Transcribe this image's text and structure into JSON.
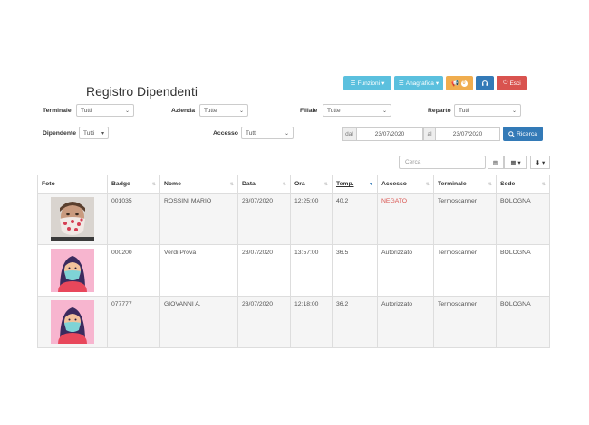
{
  "title": "Registro Dipendenti",
  "toolbar": {
    "funzioni_label": "Funzioni",
    "anagrafica_label": "Anagrafica",
    "notifications_count": "0",
    "esci_label": "Esci"
  },
  "filters": {
    "terminale": {
      "label": "Terminale",
      "value": "Tutti"
    },
    "azienda": {
      "label": "Azienda",
      "value": "Tutte"
    },
    "filiale": {
      "label": "Filiale",
      "value": "Tutte"
    },
    "reparto": {
      "label": "Reparto",
      "value": "Tutti"
    },
    "dipendente": {
      "label": "Dipendente",
      "value": "Tutti"
    },
    "accesso": {
      "label": "Accesso",
      "value": "Tutti"
    },
    "dal_label": "dal",
    "dal_value": "23/07/2020",
    "al_label": "al",
    "al_value": "23/07/2020",
    "search_button": "Ricerca"
  },
  "table_search": {
    "placeholder": "Cerca"
  },
  "table": {
    "headers": [
      "Foto",
      "Badge",
      "Nome",
      "Data",
      "Ora",
      "Temp.",
      "Accesso",
      "Terminale",
      "Sede"
    ],
    "rows": [
      {
        "avatar": "mask-photo",
        "badge": "001035",
        "nome": "ROSSINI MARIO",
        "data": "23/07/2020",
        "ora": "12:25:00",
        "temp": "40.2",
        "accesso": "NEGATO",
        "terminale": "Termoscanner",
        "sede": "BOLOGNA"
      },
      {
        "avatar": "woman-mask-icon",
        "badge": "000200",
        "nome": "Verdi Prova",
        "data": "23/07/2020",
        "ora": "13:57:00",
        "temp": "36.5",
        "accesso": "Autorizzato",
        "terminale": "Termoscanner",
        "sede": "BOLOGNA"
      },
      {
        "avatar": "woman-mask-icon",
        "badge": "077777",
        "nome": "GIOVANNI A.",
        "data": "23/07/2020",
        "ora": "12:18:00",
        "temp": "36.2",
        "accesso": "Autorizzato",
        "terminale": "Termoscanner",
        "sede": "BOLOGNA"
      }
    ]
  },
  "colors": {
    "info": "#5bc0de",
    "warning": "#f0ad4e",
    "primary": "#337ab7",
    "danger": "#d9534f"
  }
}
